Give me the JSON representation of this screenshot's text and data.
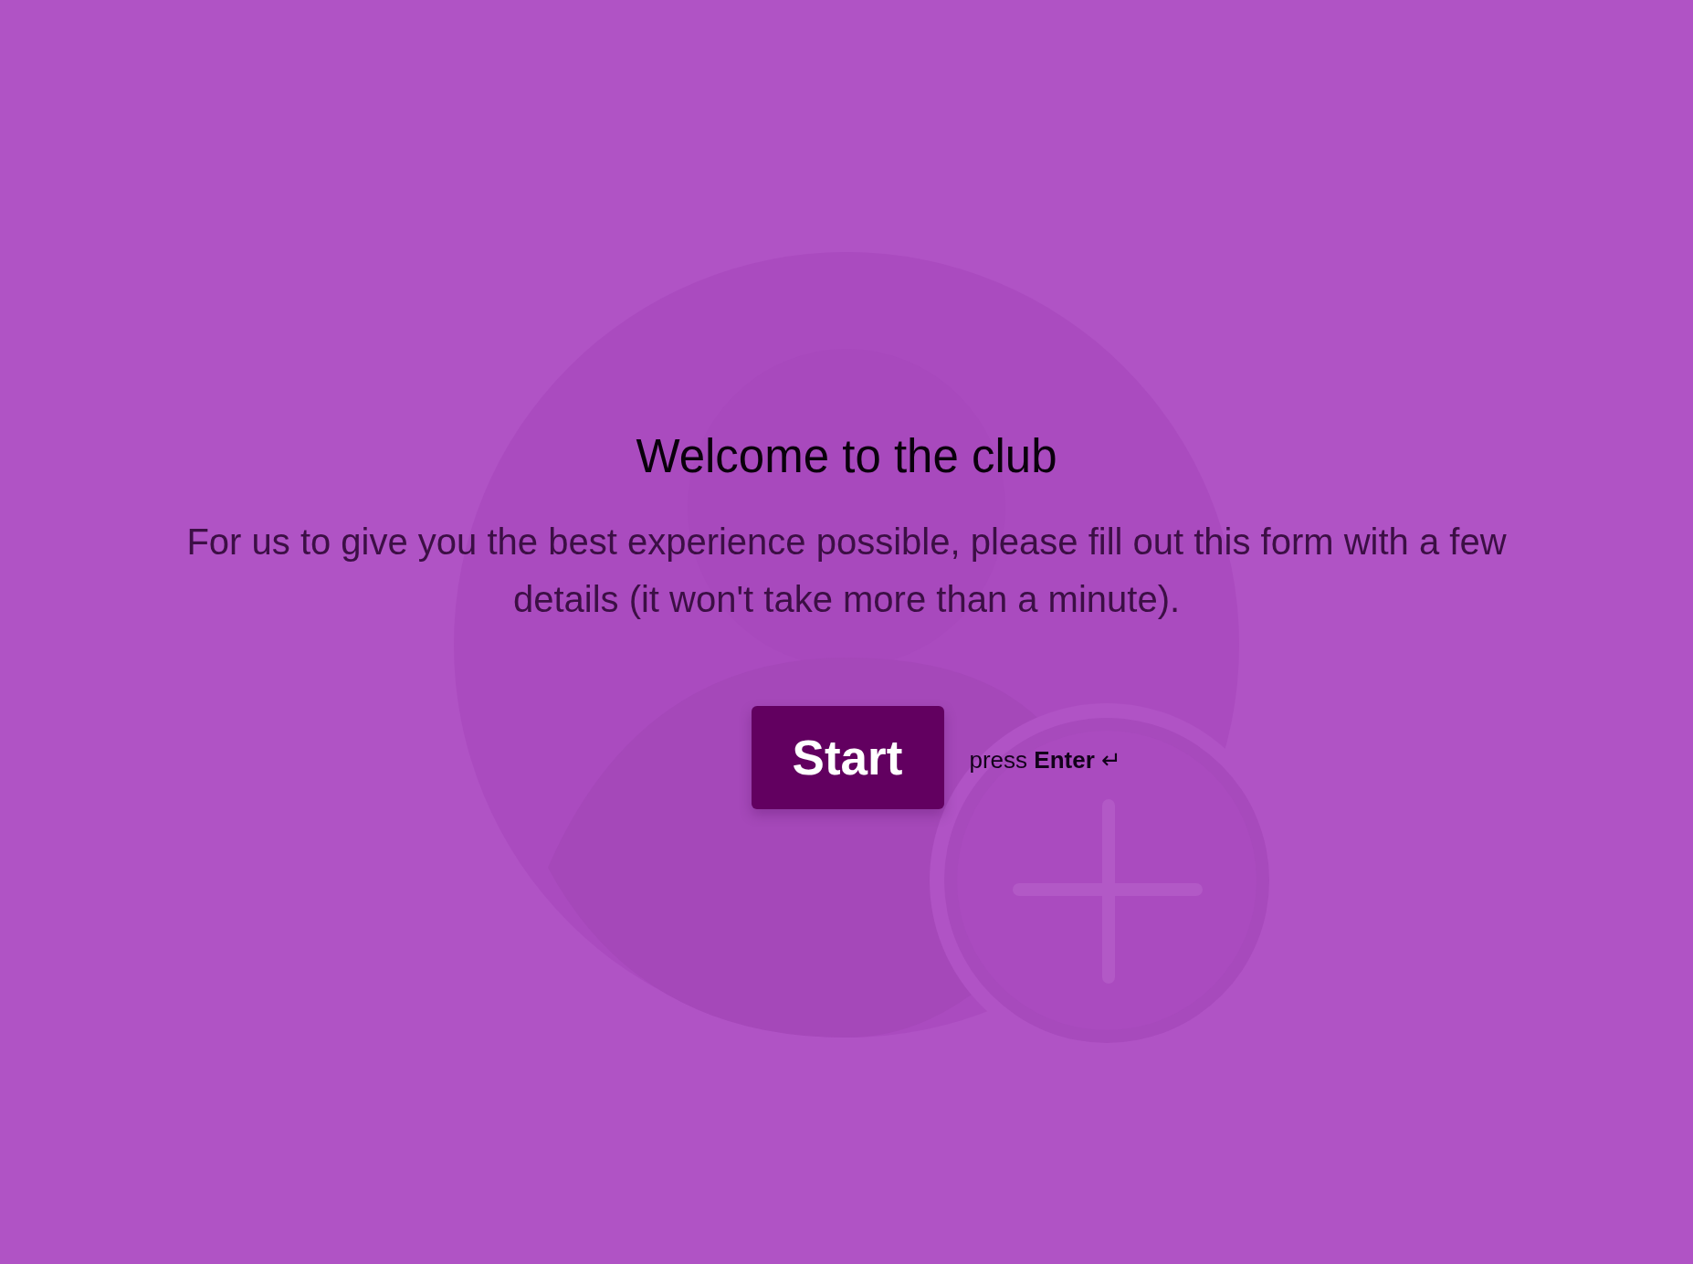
{
  "welcome": {
    "title": "Welcome to the club",
    "description": "For us to give you the best experience possible, please fill out this form with a few details (it won't take more than a minute).",
    "button": "Start",
    "hint": "press **Enter** ↵"
  }
}
